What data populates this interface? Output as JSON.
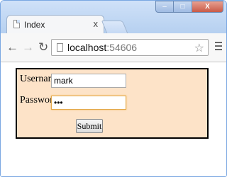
{
  "browser": {
    "tab": {
      "title": "Index",
      "close_glyph": "x"
    },
    "window_controls": {
      "minimize": "–",
      "maximize": "□",
      "close": "X"
    },
    "nav": {
      "back_icon": "arrow-left",
      "forward_icon": "arrow-right",
      "reload_icon": "reload"
    },
    "address": {
      "host": "localhost",
      "port": ":54606"
    }
  },
  "form": {
    "username_label": "Username",
    "username_value": "mark",
    "password_label": "Password",
    "password_value": "•••",
    "submit_label": "Submit"
  },
  "colors": {
    "form_background": "#fde3c8",
    "titlebar": "#cfe1f8",
    "window_border": "#7aa7e2"
  }
}
